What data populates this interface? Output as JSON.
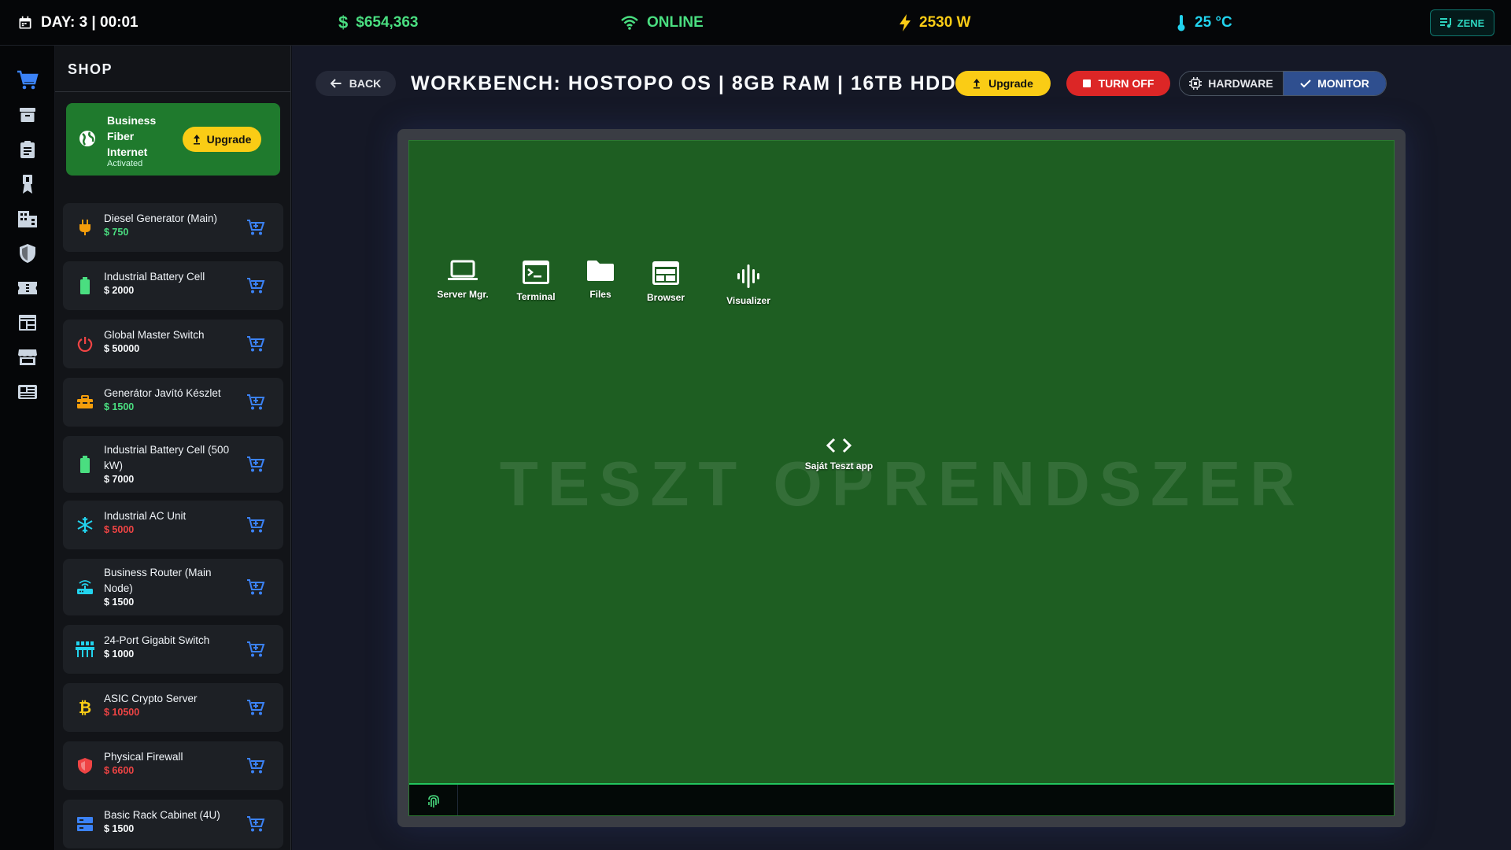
{
  "topbar": {
    "day_clock": "DAY: 3 | 00:01",
    "money": "$654,363",
    "network_status": "ONLINE",
    "power": "2530 W",
    "temperature": "25 °C",
    "music_button": "ZENE"
  },
  "shop": {
    "title": "SHOP",
    "fiber": {
      "name": "Business Fiber Internet",
      "status": "Activated",
      "upgrade_label": "Upgrade"
    },
    "items": [
      {
        "name": "Diesel Generator (Main)",
        "price": "$ 750",
        "icon": "plug-icon",
        "icon_color": "#f59e0b",
        "price_state": "affordable"
      },
      {
        "name": "Industrial Battery Cell",
        "price": "$ 2000",
        "icon": "battery-icon",
        "icon_color": "#4ade80",
        "price_state": "neutral"
      },
      {
        "name": "Global Master Switch",
        "price": "$ 50000",
        "icon": "power-icon",
        "icon_color": "#ef4444",
        "price_state": "neutral"
      },
      {
        "name": "Generátor Javító Készlet",
        "price": "$ 1500",
        "icon": "toolbox-icon",
        "icon_color": "#f59e0b",
        "price_state": "affordable"
      },
      {
        "name": "Industrial Battery Cell (500 kW)",
        "price": "$ 7000",
        "icon": "battery-icon",
        "icon_color": "#4ade80",
        "price_state": "neutral"
      },
      {
        "name": "Industrial AC Unit",
        "price": "$ 5000",
        "icon": "snowflake-icon",
        "icon_color": "#22d3ee",
        "price_state": "unaffordable"
      },
      {
        "name": "Business Router (Main Node)",
        "price": "$ 1500",
        "icon": "router-icon",
        "icon_color": "#22d3ee",
        "price_state": "neutral"
      },
      {
        "name": "24-Port Gigabit Switch",
        "price": "$ 1000",
        "icon": "network-switch-icon",
        "icon_color": "#22d3ee",
        "price_state": "neutral"
      },
      {
        "name": "ASIC Crypto Server",
        "price": "$ 10500",
        "icon": "bitcoin-icon",
        "icon_color": "#facc15",
        "price_state": "unaffordable"
      },
      {
        "name": "Physical Firewall",
        "price": "$ 6600",
        "icon": "shield-icon",
        "icon_color": "#ef4444",
        "price_state": "unaffordable"
      },
      {
        "name": "Basic Rack Cabinet (4U)",
        "price": "$ 1500",
        "icon": "rack-icon",
        "icon_color": "#3b82f6",
        "price_state": "neutral"
      }
    ]
  },
  "workbench": {
    "back_label": "BACK",
    "title": "WORKBENCH: HOSTOPO OS | 8GB RAM | 16TB HDD",
    "upgrade_label": "Upgrade",
    "turn_off_label": "TURN OFF",
    "hardware_label": "HARDWARE",
    "monitor_label": "MONITOR",
    "active_view": "MONITOR"
  },
  "desktop": {
    "watermark": "TESZT OPRENDSZER",
    "icons": [
      {
        "label": "Server Mgr.",
        "icon": "laptop-icon"
      },
      {
        "label": "Terminal",
        "icon": "terminal-icon"
      },
      {
        "label": "Files",
        "icon": "folder-icon"
      },
      {
        "label": "Browser",
        "icon": "browser-icon"
      },
      {
        "label": "Visualizer",
        "icon": "waveform-icon"
      },
      {
        "label": "Saját Teszt app",
        "icon": "code-icon"
      }
    ]
  },
  "colors": {
    "desktop_bg": "#1e5e22",
    "accent_green": "#4ade80",
    "accent_yellow": "#facc15",
    "danger": "#dc2626",
    "cart_blue": "#3b82f6"
  }
}
